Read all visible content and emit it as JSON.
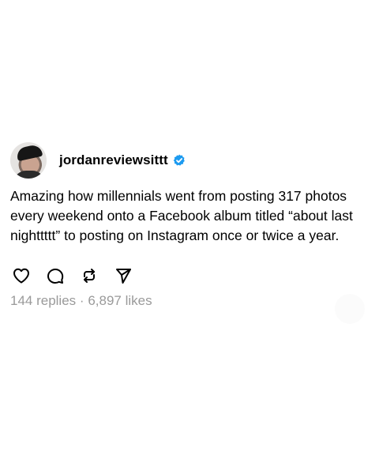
{
  "post": {
    "username": "jordanreviewsittt",
    "verified": true,
    "text": "Amazing how millennials went from posting 317 photos every weekend onto a Facebook album titled “about last nighttttt” to posting on Instagram once or twice a year.",
    "replies": "144 replies",
    "separator": "·",
    "likes": "6,897 likes"
  },
  "icons": {
    "like": "heart-icon",
    "reply": "comment-icon",
    "repost": "repost-icon",
    "share": "send-icon",
    "verified": "verified-badge-icon"
  },
  "colors": {
    "verified": "#1d9bf0",
    "stats_text": "#9a9a9a"
  }
}
